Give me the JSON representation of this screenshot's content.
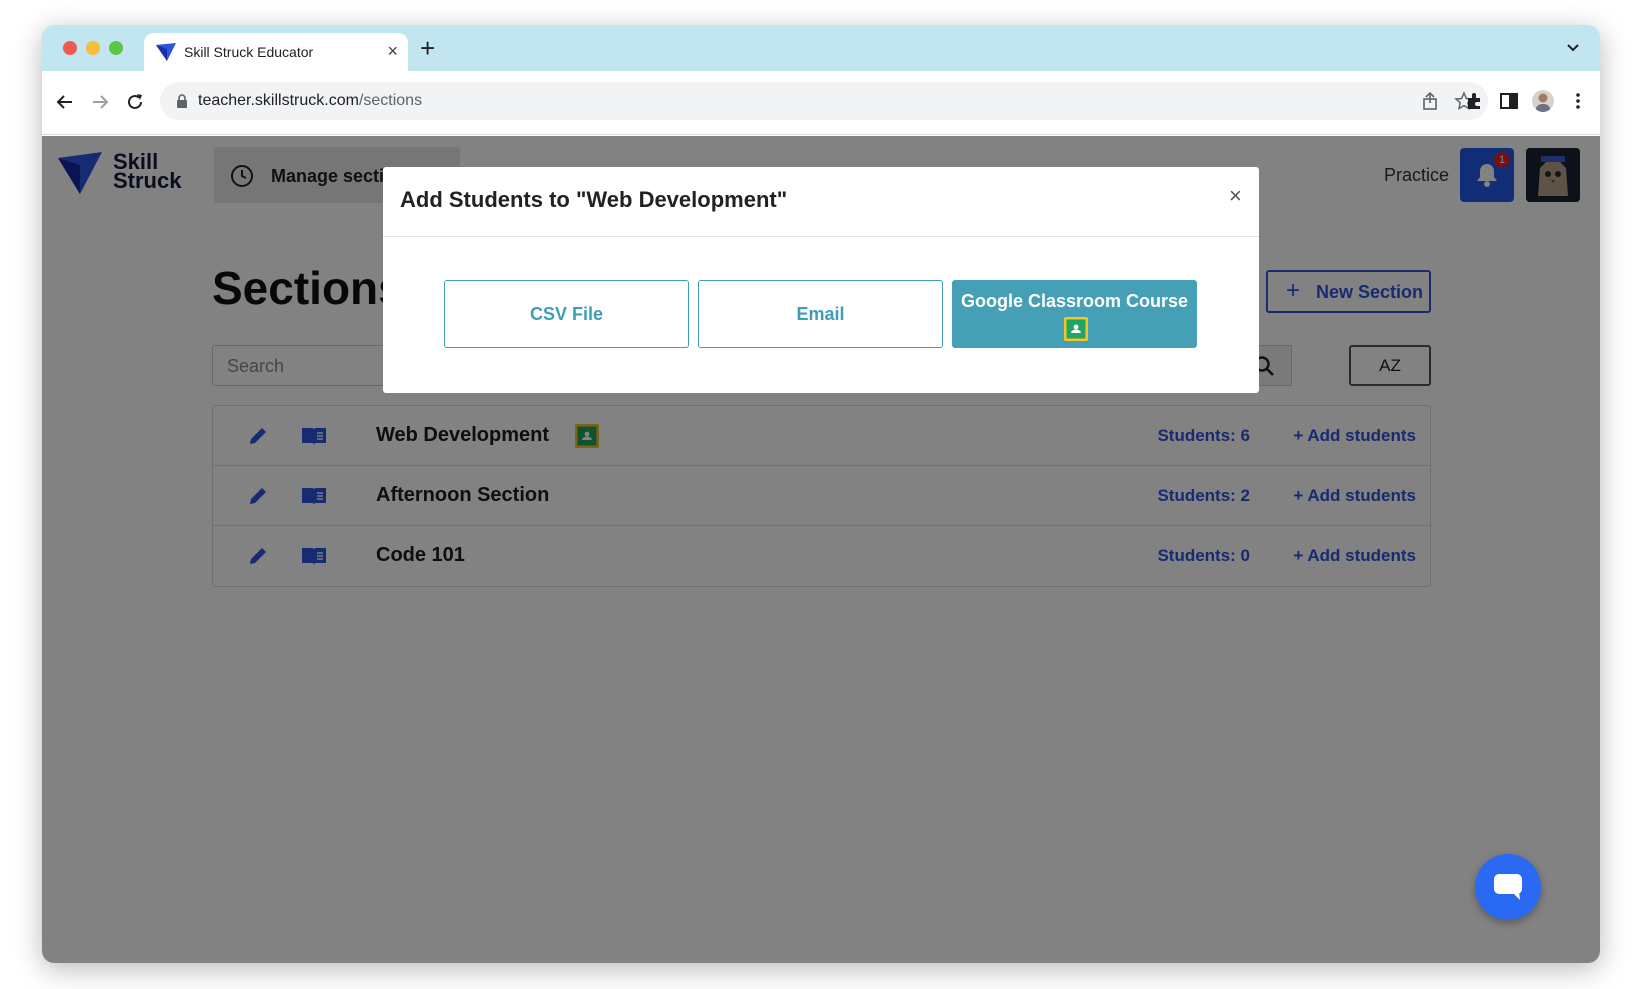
{
  "browser": {
    "tab_title": "Skill Struck Educator",
    "tab_close": "×",
    "new_tab": "+",
    "url_domain": "teacher.skillstruck.com",
    "url_path": "/sections"
  },
  "app": {
    "logo_line1": "Skill",
    "logo_line2": "Struck",
    "manage_label": "Manage sections",
    "practice_label": "Practice",
    "notification_count": "1",
    "page_title": "Sections",
    "new_section_label": "New Section",
    "new_section_plus": "+",
    "search_placeholder": "Search",
    "sort_label": "AZ",
    "sections": [
      {
        "name": "Web Development",
        "students": "Students: 6",
        "add": "+ Add students",
        "google_classroom": true
      },
      {
        "name": "Afternoon Section",
        "students": "Students: 2",
        "add": "+ Add students",
        "google_classroom": false
      },
      {
        "name": "Code 101",
        "students": "Students: 0",
        "add": "+ Add students",
        "google_classroom": false
      }
    ]
  },
  "modal": {
    "title": "Add Students to \"Web Development\"",
    "close": "×",
    "options": {
      "csv": "CSV File",
      "email": "Email",
      "google": "Google Classroom Course"
    }
  },
  "colors": {
    "brand_blue": "#2b55e0",
    "teal": "#45a0b6",
    "tab_strip": "#c2e6ef",
    "overlay": "rgba(0,0,0,0.49)"
  },
  "icons": [
    "skill-struck-logo-icon",
    "clock-icon",
    "bell-icon",
    "search-icon",
    "pencil-icon",
    "book-icon",
    "google-classroom-icon",
    "chat-icon"
  ]
}
